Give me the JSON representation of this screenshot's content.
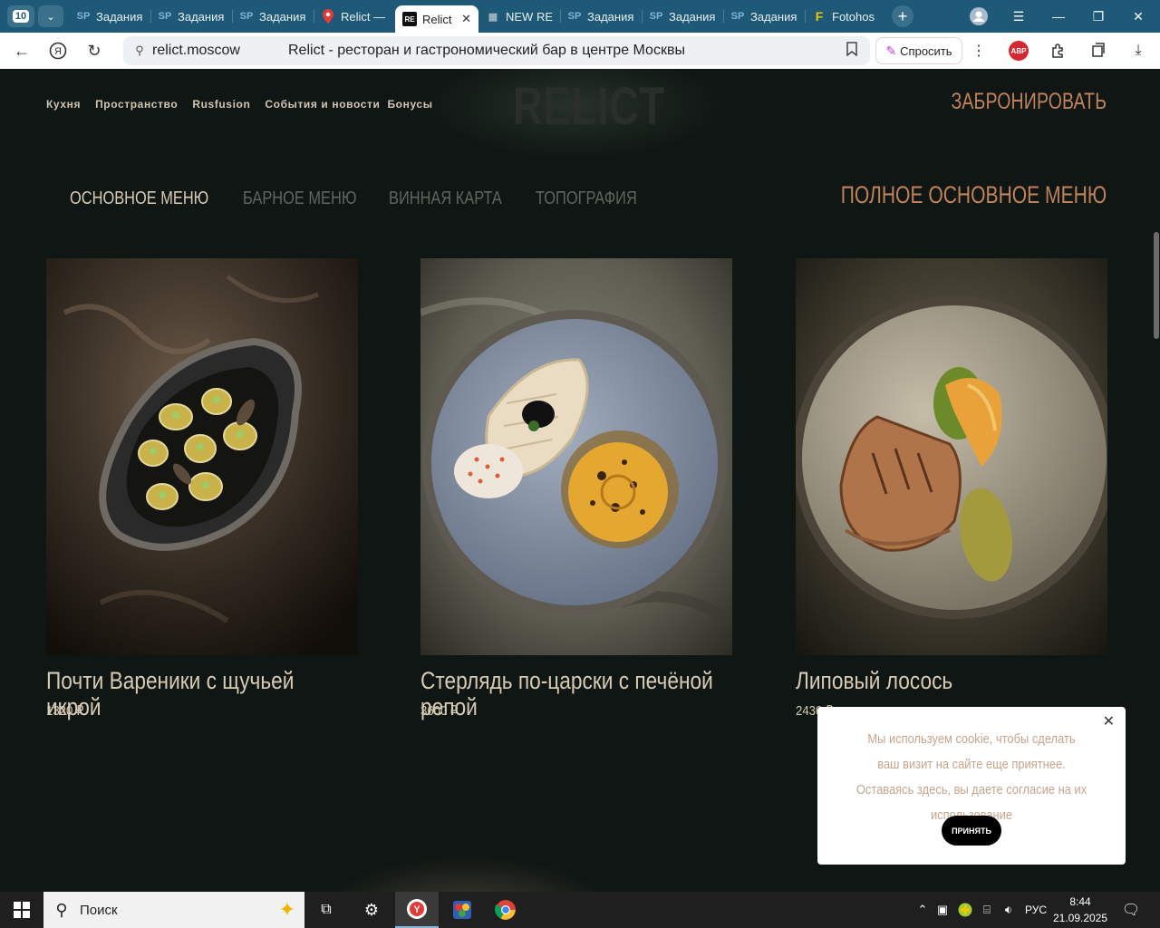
{
  "browser": {
    "tab_count": "10",
    "tabs": [
      {
        "label": "Задания",
        "icon": "SP"
      },
      {
        "label": "Задания",
        "icon": "SP"
      },
      {
        "label": "Задания",
        "icon": "SP"
      },
      {
        "label": "Relict —",
        "icon": "map-pin"
      },
      {
        "label": "Relict",
        "icon": "RE",
        "active": true
      },
      {
        "label": "NEW RE",
        "icon": "grid"
      },
      {
        "label": "Задания",
        "icon": "SP"
      },
      {
        "label": "Задания",
        "icon": "SP"
      },
      {
        "label": "Задания",
        "icon": "SP"
      },
      {
        "label": "Fotohos",
        "icon": "F"
      }
    ],
    "address": {
      "domain": "relict.moscow",
      "page_title": "Relict - ресторан и гастрономический бар в центре Москвы"
    },
    "ask_label": "Спросить",
    "abp_label": "ABP",
    "colors": {
      "tabstrip": "#1e5a77",
      "accent_orange": "#c1835c"
    }
  },
  "site": {
    "logo": "RELICT",
    "nav": [
      "Кухня",
      "Пространство",
      "Rusfusion",
      "События и новости",
      "Бонусы"
    ],
    "book_label": "ЗАБРОНИРОВАТЬ",
    "menu_tabs": [
      "ОСНОВНОЕ МЕНЮ",
      "БАРНОЕ МЕНЮ",
      "ВИННАЯ КАРТА",
      "ТОПОГРАФИЯ"
    ],
    "active_menu_tab": "ОСНОВНОЕ МЕНЮ",
    "full_menu_label": "ПОЛНОЕ ОСНОВНОЕ МЕНЮ",
    "dishes": [
      {
        "name": "Почти Вареники с щучьей икрой",
        "price": "1320 ₽"
      },
      {
        "name": "Стерлядь по-царски с печёной репой",
        "price": "3600 ₽"
      },
      {
        "name": "Липовый лосось",
        "price": "2430 ₽"
      }
    ],
    "cookie": {
      "text": "Мы используем cookie, чтобы сделать ваш визит на сайте еще приятнее. Оставаясь здесь, вы даете согласие на их использование",
      "accept": "ПРИНЯТЬ"
    }
  },
  "taskbar": {
    "search_placeholder": "Поиск",
    "lang": "РУС",
    "time": "8:44",
    "date": "21.09.2025"
  }
}
